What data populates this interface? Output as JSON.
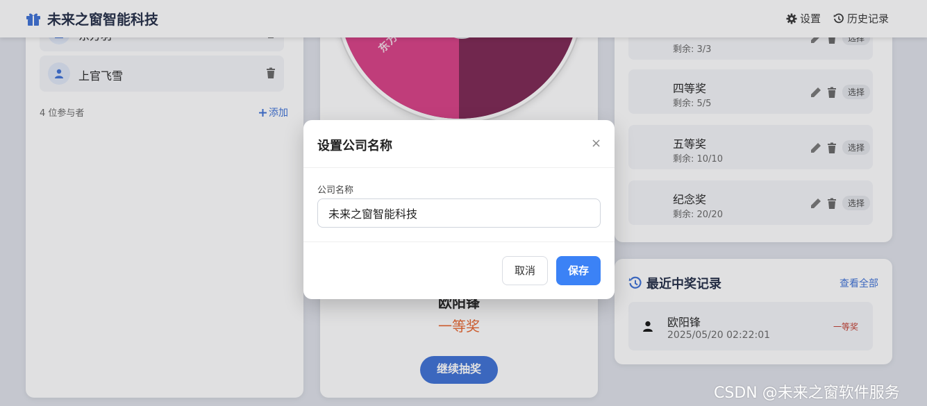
{
  "header": {
    "brand_title": "未来之窗智能科技",
    "nav": {
      "settings_label": "设置",
      "history_label": "历史记录"
    }
  },
  "participants": {
    "items": [
      {
        "name": "东方羽"
      },
      {
        "name": "上官飞雪"
      }
    ],
    "count_text": "4 位参与者",
    "add_label": "添加"
  },
  "lottery": {
    "wheel_segment_label": "东方羽",
    "winner_name": "欧阳锋",
    "winner_prize": "一等奖",
    "continue_label": "继续抽奖"
  },
  "prizes": {
    "items": [
      {
        "name": "",
        "remaining": "剩余: 3/3",
        "select_label": "选择"
      },
      {
        "name": "四等奖",
        "remaining": "剩余: 5/5",
        "select_label": "选择"
      },
      {
        "name": "五等奖",
        "remaining": "剩余: 10/10",
        "select_label": "选择"
      },
      {
        "name": "纪念奖",
        "remaining": "剩余: 20/20",
        "select_label": "选择"
      }
    ]
  },
  "recent": {
    "title": "最近中奖记录",
    "view_all_label": "查看全部",
    "records": [
      {
        "name": "欧阳锋",
        "time": "2025/05/20 02:22:01",
        "prize": "一等奖"
      }
    ]
  },
  "modal": {
    "title": "设置公司名称",
    "close_symbol": "×",
    "field_label": "公司名称",
    "field_value": "未来之窗智能科技",
    "cancel_label": "取消",
    "save_label": "保存"
  },
  "watermark": "CSDN @未来之窗软件服务",
  "colors": {
    "accent": "#3b6fd6",
    "save_button": "#3b82f6",
    "prize_highlight": "#e8622a",
    "wheel_pink": "#d93d85",
    "wheel_dark": "#7b2350"
  }
}
